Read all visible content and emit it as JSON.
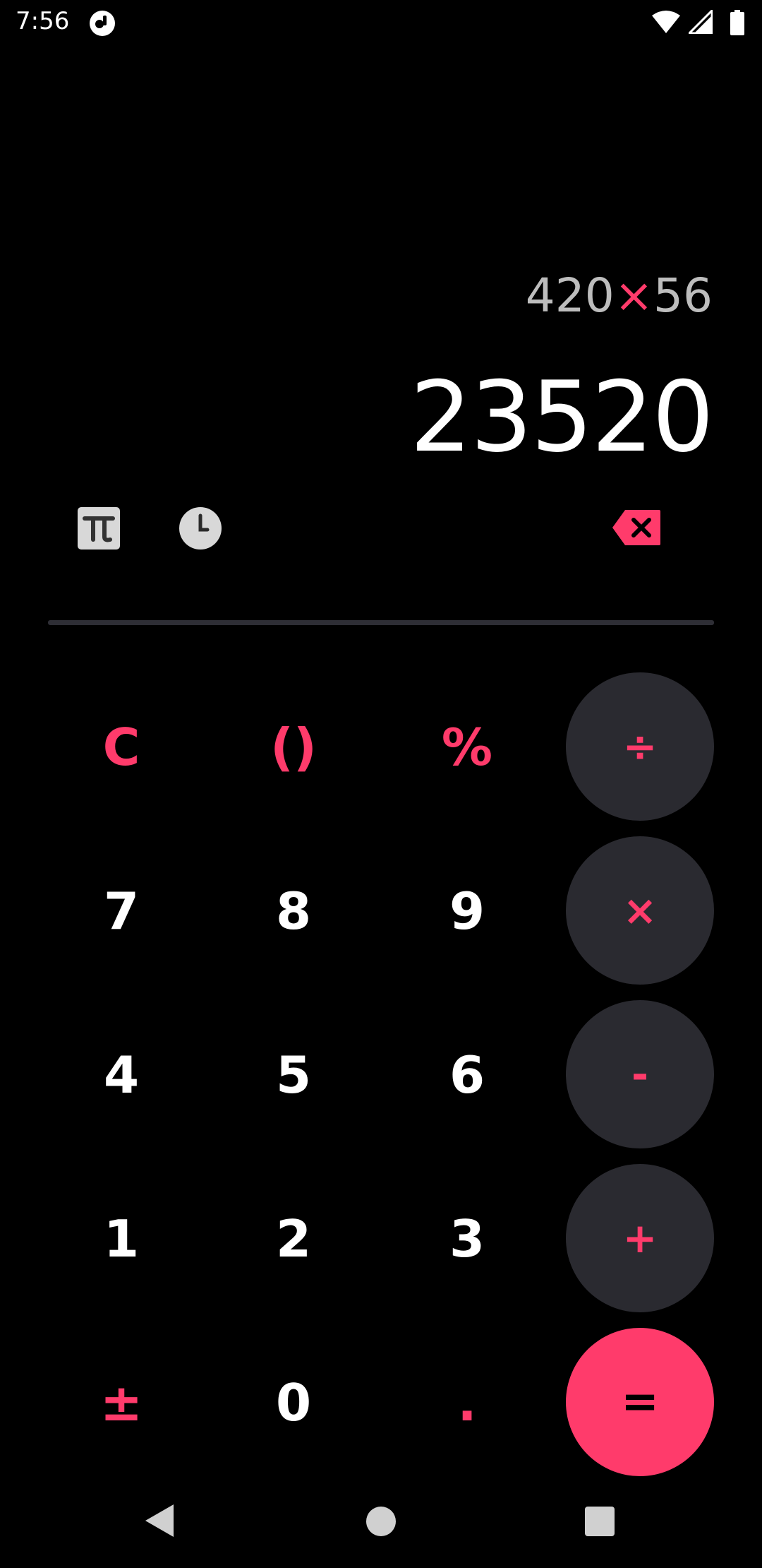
{
  "status_bar": {
    "time": "7:56",
    "icons": [
      "app-notification-icon",
      "wifi-icon",
      "cell-signal-icon",
      "battery-icon"
    ]
  },
  "display": {
    "expression_left": "420",
    "expression_op": "×",
    "expression_right": "56",
    "result": "23520"
  },
  "toolbar": {
    "icons": [
      "pi-icon",
      "history-clock-icon",
      "backspace-icon"
    ]
  },
  "keypad": {
    "clear": "C",
    "parentheses": "()",
    "percent": "%",
    "divide": "÷",
    "seven": "7",
    "eight": "8",
    "nine": "9",
    "multiply": "×",
    "four": "4",
    "five": "5",
    "six": "6",
    "minus": "-",
    "one": "1",
    "two": "2",
    "three": "3",
    "plus": "+",
    "plus_minus": "±",
    "zero": "0",
    "decimal": ".",
    "equals": "="
  },
  "nav_bar": {
    "icons": [
      "back-icon",
      "home-icon",
      "recents-icon"
    ]
  },
  "colors": {
    "accent": "#ff3b6b",
    "background": "#000000",
    "operator_button": "#2a2a30",
    "expression_text": "#bdbdbd"
  }
}
